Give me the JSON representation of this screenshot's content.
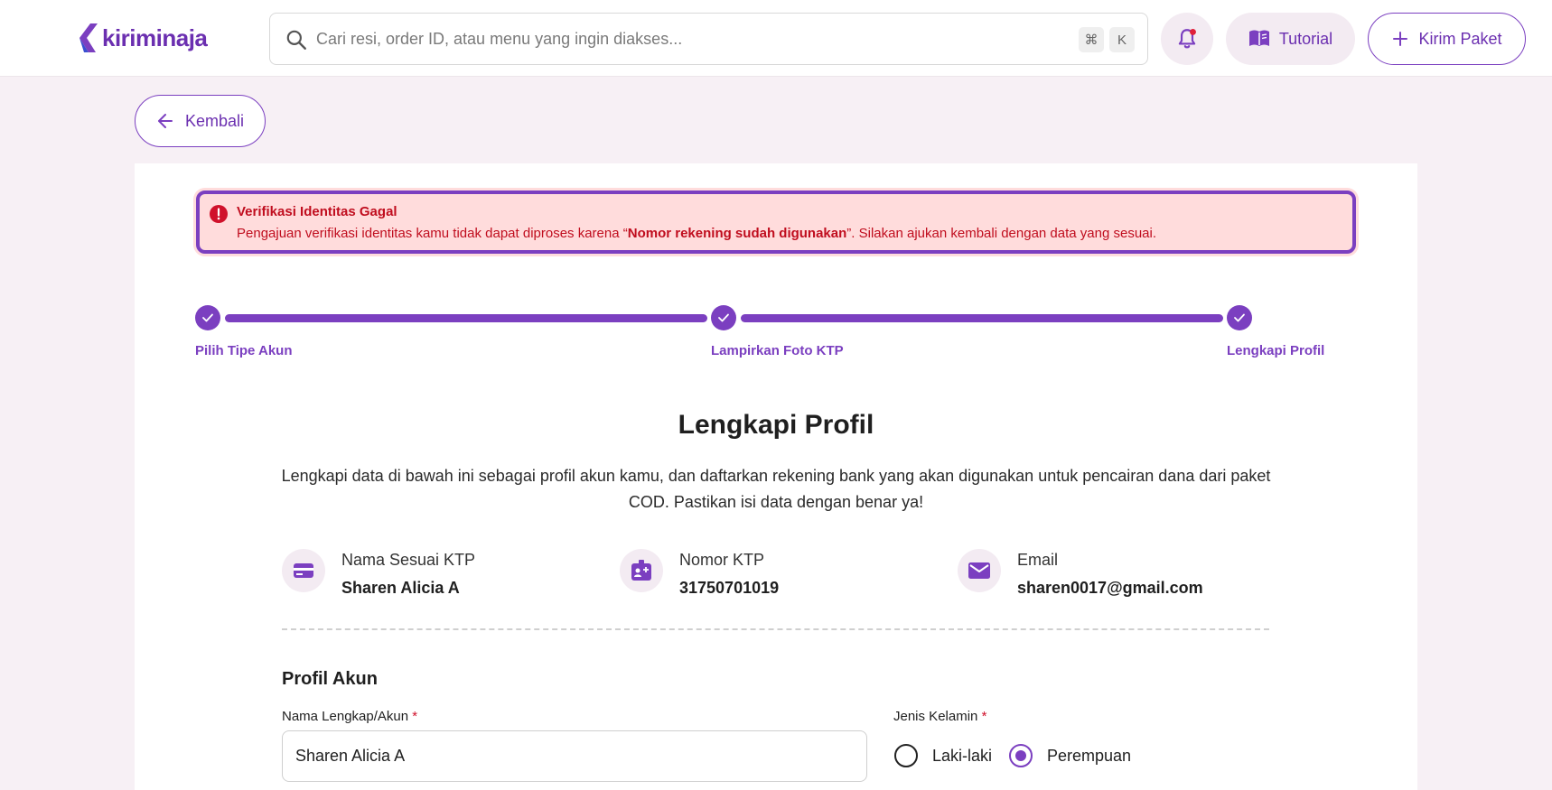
{
  "header": {
    "logo_text": "kiriminaja",
    "search_placeholder": "Cari resi, order ID, atau menu yang ingin diakses...",
    "shortcut_keys": [
      "⌘",
      "K"
    ],
    "tutorial_label": "Tutorial",
    "kirim_label": "Kirim Paket"
  },
  "back_label": "Kembali",
  "alert": {
    "title": "Verifikasi Identitas Gagal",
    "message_prefix": "Pengajuan verifikasi identitas kamu tidak dapat diproses karena “",
    "message_bold": "Nomor rekening sudah digunakan",
    "message_suffix": "”. Silakan ajukan kembali dengan data yang sesuai."
  },
  "steps": [
    {
      "label": "Pilih Tipe Akun",
      "done": true
    },
    {
      "label": "Lampirkan Foto KTP",
      "done": true
    },
    {
      "label": "Lengkapi Profil",
      "done": true
    }
  ],
  "page": {
    "title": "Lengkapi Profil",
    "description": "Lengkapi data di bawah ini sebagai profil akun kamu, dan daftarkan rekening bank yang akan digunakan untuk pencairan dana dari paket COD. Pastikan isi data dengan benar ya!"
  },
  "info": [
    {
      "label": "Nama Sesuai KTP",
      "value": "Sharen Alicia A",
      "icon": "card-icon"
    },
    {
      "label": "Nomor KTP",
      "value": "31750701019",
      "icon": "id-badge-icon"
    },
    {
      "label": "Email",
      "value": "sharen0017@gmail.com",
      "icon": "mail-icon"
    }
  ],
  "form": {
    "section_title": "Profil Akun",
    "name_label": "Nama Lengkap/Akun",
    "name_value": "Sharen Alicia A",
    "required_mark": "*",
    "gender_label": "Jenis Kelamin",
    "gender_options": [
      "Laki-laki",
      "Perempuan"
    ],
    "gender_selected": "Perempuan"
  },
  "colors": {
    "brand": "#7b3fc0",
    "alert_bg": "#ffdcdc",
    "alert_text": "#c00d1e",
    "page_bg": "#f7f0f5"
  }
}
